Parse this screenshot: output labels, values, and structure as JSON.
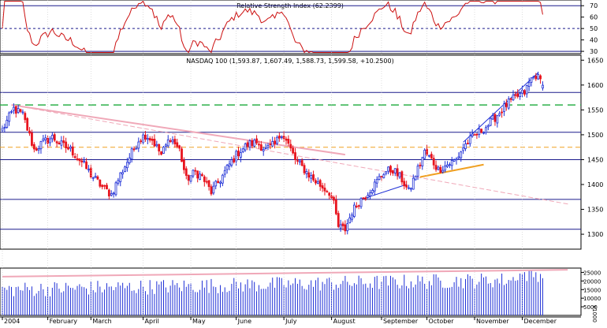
{
  "chart_data": {
    "type": "candlestick",
    "symbol": "NASDAQ 100",
    "ohlc_readout": "NASDAQ 100 (1,593.87, 1,607.49, 1,588.73, 1,599.58, +10.2500)",
    "last_bar": {
      "open": 1593.87,
      "high": 1607.49,
      "low": 1588.73,
      "close": 1599.58,
      "change": 10.25
    },
    "colors": {
      "up": "#1e2fd6",
      "down": "#e8141e",
      "rsi_line": "#cc1010",
      "support_resistance": "#1a1a8c",
      "trend_pink": "#f0a8b8",
      "dashed_green": "#2db04a",
      "dashed_orange": "#f0a020",
      "orange_trend": "#f0a020",
      "blue_trend": "#1e2fd6",
      "volume": "#1e2fd6",
      "volume_trend": "#f0a8b8"
    },
    "x_axis": {
      "months": [
        "2004",
        "February",
        "March",
        "April",
        "May",
        "June",
        "July",
        "August",
        "September",
        "October",
        "November",
        "December"
      ],
      "month_start_index": [
        0,
        20,
        39,
        62,
        83,
        103,
        124,
        145,
        167,
        187,
        208,
        229
      ]
    },
    "price_panel": {
      "ylim": [
        1270,
        1660
      ],
      "y_ticks": [
        1650,
        1600,
        1550,
        1500,
        1450,
        1400,
        1350,
        1300
      ],
      "horizontal_levels": [
        1585,
        1505,
        1450,
        1370,
        1310
      ],
      "dashed_green_level": 1560,
      "dashed_orange_level": 1475,
      "pink_trendlines": [
        {
          "from": {
            "bar": 4,
            "value": 1560
          },
          "to": {
            "bar": 151,
            "value": 1460
          }
        },
        {
          "from": {
            "bar": 4,
            "value": 1560
          },
          "to": {
            "bar": 250,
            "value": 1360
          }
        }
      ],
      "orange_trendlines": [
        {
          "from": {
            "bar": 184,
            "value": 1415
          },
          "to": {
            "bar": 212,
            "value": 1440
          }
        }
      ],
      "blue_trendlines": [
        {
          "from": {
            "bar": 158,
            "value": 1370
          },
          "to": {
            "bar": 178,
            "value": 1400
          }
        },
        {
          "from": {
            "bar": 203,
            "value": 1485
          },
          "to": {
            "bar": 236,
            "value": 1625
          }
        }
      ]
    },
    "rsi_panel": {
      "title": "Relative Strength Index (62.2399)",
      "ylim": [
        28,
        75
      ],
      "y_ticks": [
        70,
        60,
        50,
        40,
        30
      ],
      "solid_levels": [
        70,
        30
      ],
      "dashed_level": 50
    },
    "volume_panel": {
      "ylim": [
        0,
        27500
      ],
      "y_ticks": [
        25000,
        20000,
        15000,
        10000,
        5000
      ],
      "unit_label": "x1000"
    },
    "anchors": [
      {
        "i": 0,
        "c": 1510
      },
      {
        "i": 5,
        "c": 1552
      },
      {
        "i": 9,
        "c": 1540
      },
      {
        "i": 14,
        "c": 1470
      },
      {
        "i": 18,
        "c": 1485
      },
      {
        "i": 22,
        "c": 1495
      },
      {
        "i": 26,
        "c": 1480
      },
      {
        "i": 30,
        "c": 1470
      },
      {
        "i": 35,
        "c": 1445
      },
      {
        "i": 39,
        "c": 1420
      },
      {
        "i": 44,
        "c": 1395
      },
      {
        "i": 48,
        "c": 1380
      },
      {
        "i": 52,
        "c": 1420
      },
      {
        "i": 56,
        "c": 1455
      },
      {
        "i": 60,
        "c": 1490
      },
      {
        "i": 63,
        "c": 1500
      },
      {
        "i": 66,
        "c": 1490
      },
      {
        "i": 70,
        "c": 1460
      },
      {
        "i": 74,
        "c": 1495
      },
      {
        "i": 78,
        "c": 1470
      },
      {
        "i": 81,
        "c": 1410
      },
      {
        "i": 85,
        "c": 1425
      },
      {
        "i": 88,
        "c": 1415
      },
      {
        "i": 92,
        "c": 1385
      },
      {
        "i": 96,
        "c": 1410
      },
      {
        "i": 100,
        "c": 1440
      },
      {
        "i": 104,
        "c": 1465
      },
      {
        "i": 108,
        "c": 1480
      },
      {
        "i": 112,
        "c": 1485
      },
      {
        "i": 116,
        "c": 1470
      },
      {
        "i": 120,
        "c": 1480
      },
      {
        "i": 123,
        "c": 1505
      },
      {
        "i": 126,
        "c": 1480
      },
      {
        "i": 129,
        "c": 1450
      },
      {
        "i": 133,
        "c": 1430
      },
      {
        "i": 137,
        "c": 1410
      },
      {
        "i": 141,
        "c": 1395
      },
      {
        "i": 144,
        "c": 1385
      },
      {
        "i": 146,
        "c": 1360
      },
      {
        "i": 148,
        "c": 1315
      },
      {
        "i": 151,
        "c": 1310
      },
      {
        "i": 154,
        "c": 1345
      },
      {
        "i": 157,
        "c": 1365
      },
      {
        "i": 160,
        "c": 1380
      },
      {
        "i": 164,
        "c": 1400
      },
      {
        "i": 168,
        "c": 1425
      },
      {
        "i": 172,
        "c": 1430
      },
      {
        "i": 176,
        "c": 1410
      },
      {
        "i": 179,
        "c": 1385
      },
      {
        "i": 182,
        "c": 1420
      },
      {
        "i": 186,
        "c": 1465
      },
      {
        "i": 189,
        "c": 1450
      },
      {
        "i": 192,
        "c": 1430
      },
      {
        "i": 196,
        "c": 1440
      },
      {
        "i": 200,
        "c": 1450
      },
      {
        "i": 203,
        "c": 1475
      },
      {
        "i": 206,
        "c": 1490
      },
      {
        "i": 210,
        "c": 1505
      },
      {
        "i": 214,
        "c": 1520
      },
      {
        "i": 218,
        "c": 1540
      },
      {
        "i": 222,
        "c": 1560
      },
      {
        "i": 226,
        "c": 1575
      },
      {
        "i": 230,
        "c": 1585
      },
      {
        "i": 233,
        "c": 1612
      },
      {
        "i": 235,
        "c": 1620
      },
      {
        "i": 237,
        "c": 1608
      },
      {
        "i": 238,
        "c": 1600
      }
    ]
  }
}
